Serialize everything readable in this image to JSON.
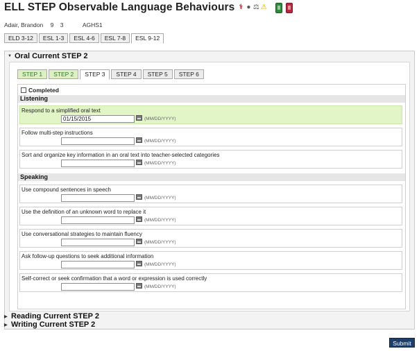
{
  "page": {
    "title": "ELL STEP Observable Language Behaviours",
    "title_icons": [
      "medical-alert-icon",
      "person-icon",
      "scale-icon",
      "warning-icon"
    ],
    "docs": [
      "green-document-icon",
      "red-document-icon"
    ]
  },
  "student": {
    "name": "Adair, Brandon",
    "grade": "9",
    "number": "3",
    "school": "AGHS1"
  },
  "grade_tabs": [
    "ELD 3-12",
    "ESL 1-3",
    "ESL 4-6",
    "ESL 7-8",
    "ESL 9-12"
  ],
  "active_grade_tab": "ESL 9-12",
  "sections": {
    "oral": "Oral Current STEP 2",
    "reading": "Reading Current STEP 2",
    "writing": "Writing Current STEP 2"
  },
  "step_tabs": [
    "STEP 1",
    "STEP 2",
    "STEP 3",
    "STEP 4",
    "STEP 5",
    "STEP 6"
  ],
  "active_step": "STEP 3",
  "completed_label": "Completed",
  "date_format": "(MM/DD/YYYY)",
  "listening": {
    "heading": "Listening",
    "items": [
      {
        "label": "Respond to a simplified oral text",
        "value": "01/15/2015"
      },
      {
        "label": "Follow multi-step instructions",
        "value": ""
      },
      {
        "label": "Sort and organize key information in an oral text into teacher-selected categories",
        "value": ""
      }
    ]
  },
  "speaking": {
    "heading": "Speaking",
    "items": [
      {
        "label": "Use compound sentences in speech",
        "value": ""
      },
      {
        "label": "Use the definition of an unknown word to replace it",
        "value": ""
      },
      {
        "label": "Use conversational strategies to maintain fluency",
        "value": ""
      },
      {
        "label": "Ask follow-up questions to seek additional information",
        "value": ""
      },
      {
        "label": "Self-correct or seek confirmation that a word or expression is used correctly",
        "value": ""
      }
    ]
  },
  "submit_label": "Submit",
  "colors": {
    "highlight_row": "#e1f5c6",
    "done_step": "#dfefc4",
    "submit": "#1f3e6a"
  }
}
